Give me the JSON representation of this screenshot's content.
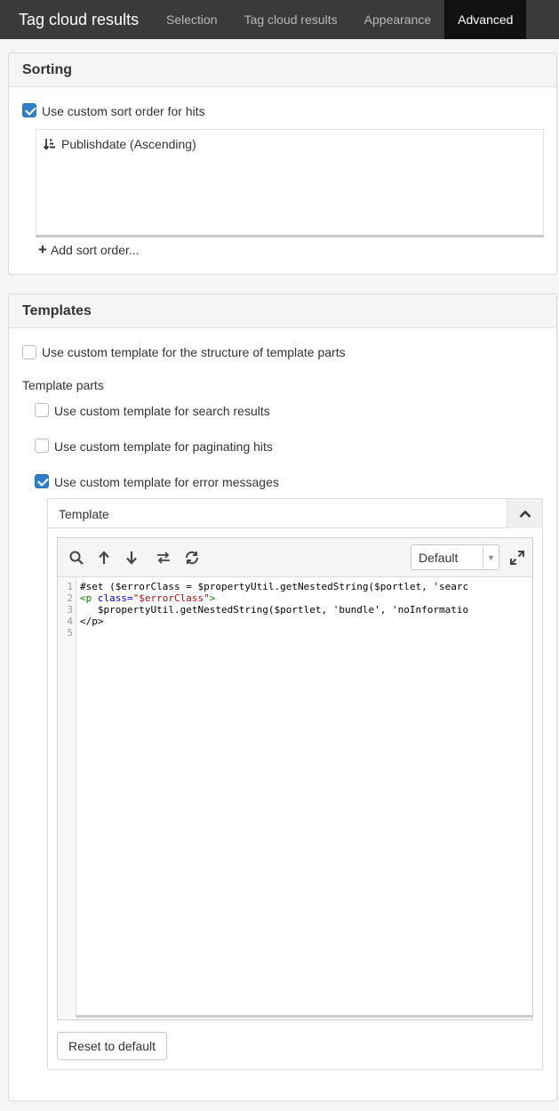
{
  "header": {
    "title": "Tag cloud results",
    "tabs": [
      {
        "label": "Selection",
        "active": false
      },
      {
        "label": "Tag cloud results",
        "active": false
      },
      {
        "label": "Appearance",
        "active": false
      },
      {
        "label": "Advanced",
        "active": true
      }
    ]
  },
  "sorting": {
    "title": "Sorting",
    "custom_sort_label": "Use custom sort order for hits",
    "custom_sort_checked": true,
    "items": [
      {
        "icon": "sort-ascending-icon",
        "label": "Publishdate (Ascending)"
      }
    ],
    "add_label": "Add sort order..."
  },
  "templates": {
    "title": "Templates",
    "structure_label": "Use custom template for the structure of template parts",
    "structure_checked": false,
    "parts_heading": "Template parts",
    "parts": [
      {
        "label": "Use custom template for search results",
        "checked": false
      },
      {
        "label": "Use custom template for paginating hits",
        "checked": false
      },
      {
        "label": "Use custom template for error messages",
        "checked": true
      }
    ],
    "template_panel": {
      "title": "Template",
      "mode_select": "Default",
      "line_numbers": [
        "1",
        "2",
        "3",
        "4",
        "5"
      ],
      "code": {
        "line1": "#set ($errorClass = $propertyUtil.getNestedString($portlet, 'searc",
        "line2_open": "<p",
        "line2_attr": " class=",
        "line2_val": "\"$errorClass\"",
        "line2_close": ">",
        "line3": "   $propertyUtil.getNestedString($portlet, 'bundle', 'noInformatio",
        "line4": "</p>",
        "line5": ""
      },
      "reset_label": "Reset to default"
    }
  },
  "colors": {
    "topbar_bg": "#3a3a3a",
    "active_tab_bg": "#111111",
    "checkbox_checked": "#2f7fc8"
  }
}
